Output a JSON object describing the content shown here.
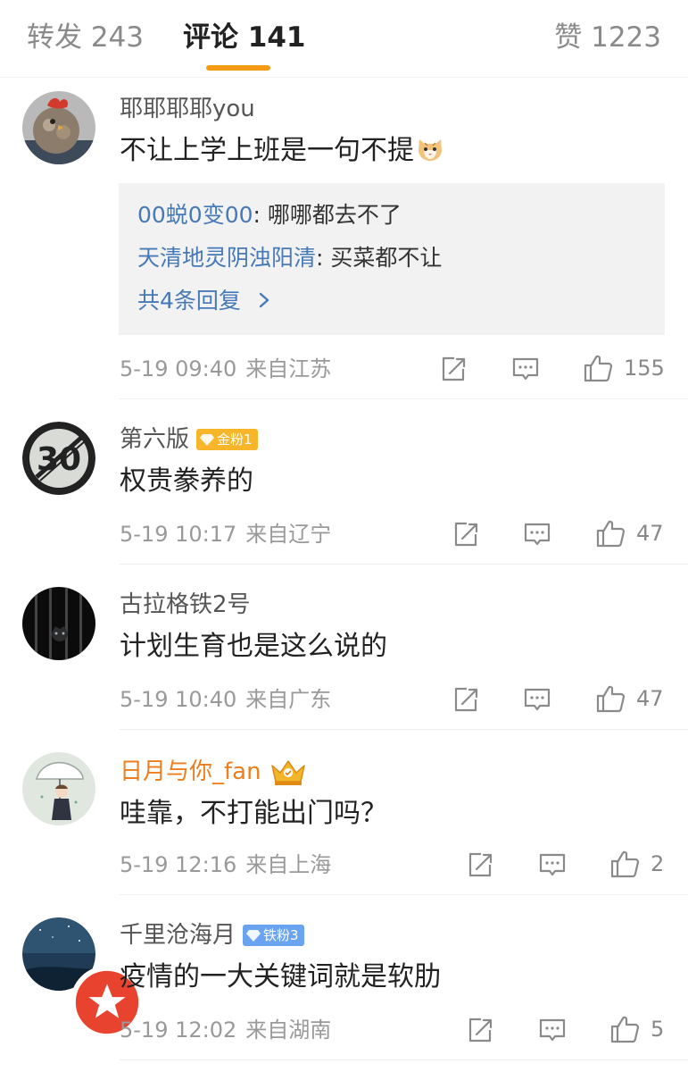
{
  "tabs": {
    "repost": "转发 243",
    "comments": "评论 141",
    "likes": "赞 1223"
  },
  "colors": {
    "accent": "#f59a14",
    "link": "#4679b8",
    "vip_name": "#ee7e1d"
  },
  "comments": [
    {
      "username": "耶耶耶耶you",
      "avatar": "rooster-plush-avatar",
      "text": "不让上学上班是一句不提",
      "emoji": "cat-emoji",
      "replies": [
        {
          "user": "00蜕0变00",
          "sep": ": ",
          "text": "哪哪都去不了"
        },
        {
          "user": "天清地灵阴浊阳清",
          "sep": ": ",
          "text": "买菜都不让"
        }
      ],
      "more_replies": "共4条回复",
      "time": "5-19 09:40",
      "location": "来自江苏",
      "likes": "155"
    },
    {
      "username": "第六版",
      "avatar": "speed-limit-30-avatar",
      "badge": "金粉1",
      "text": "权贵豢养的",
      "time": "5-19 10:17",
      "location": "来自辽宁",
      "likes": "47"
    },
    {
      "username": "古拉格铁2号",
      "avatar": "caged-cat-avatar",
      "text": "计划生育也是这么说的",
      "time": "5-19 10:40",
      "location": "来自广东",
      "likes": "47"
    },
    {
      "username": "日月与你_fan",
      "avatar": "umbrella-girl-avatar",
      "crown": "crown-icon",
      "text": "哇靠，不打能出门吗？",
      "time": "5-19 12:16",
      "location": "来自上海",
      "likes": "2"
    },
    {
      "username": "千里沧海月",
      "avatar": "night-sky-avatar",
      "badge": "铁粉3",
      "text": "疫情的一大关键词就是软肋",
      "time": "5-19 12:02",
      "location": "来自湖南",
      "likes": "5"
    }
  ]
}
